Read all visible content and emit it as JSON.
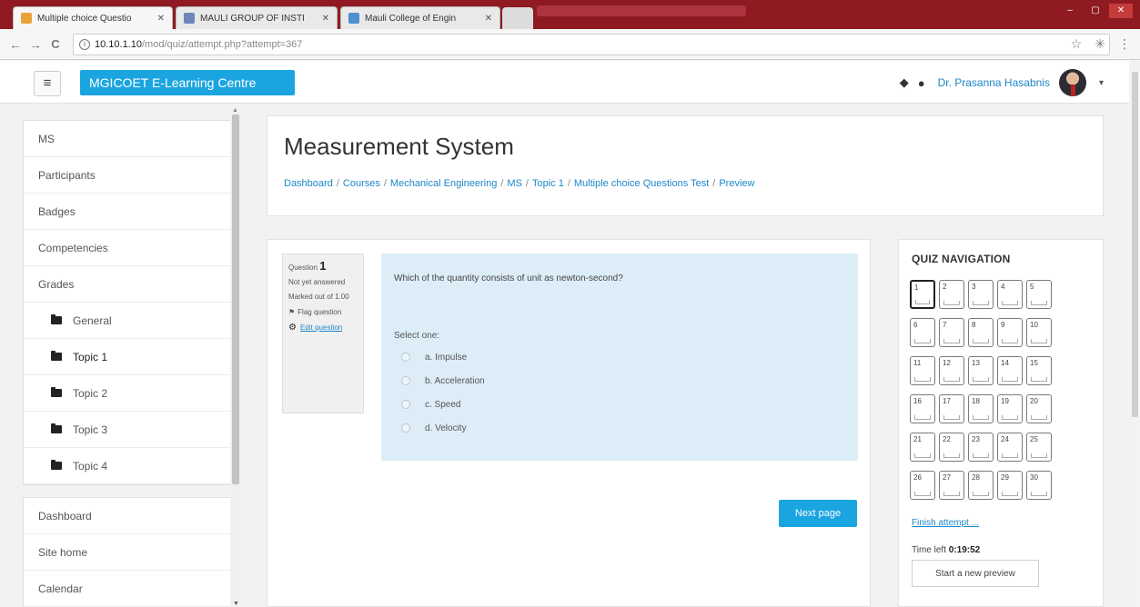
{
  "browser": {
    "tabs": [
      {
        "label": "Multiple choice Questio",
        "color": "#e8a23a",
        "active": true
      },
      {
        "label": "MAULI GROUP OF INSTI",
        "color": "#6c86b8",
        "active": false
      },
      {
        "label": "Mauli College of Engin",
        "color": "#4e8fd0",
        "active": false
      }
    ],
    "url_host": "10.10.1.10",
    "url_path": "/mod/quiz/attempt.php?attempt=367",
    "back": "←",
    "forward": "→",
    "reload": "C",
    "star": "☆",
    "menu": "⋮"
  },
  "topnav": {
    "brand": "MGICOET E-Learning Centre",
    "hamburger": "≡",
    "user_name": "Dr. Prasanna Hasabnis",
    "bell": "🔔",
    "chat": "💬",
    "caret": "▾"
  },
  "drawer": {
    "items": [
      {
        "label": "MS",
        "type": "plain"
      },
      {
        "label": "Participants",
        "type": "plain"
      },
      {
        "label": "Badges",
        "type": "plain"
      },
      {
        "label": "Competencies",
        "type": "plain"
      },
      {
        "label": "Grades",
        "type": "plain"
      },
      {
        "label": "General",
        "type": "folder"
      },
      {
        "label": "Topic 1",
        "type": "folder"
      },
      {
        "label": "Topic 2",
        "type": "folder"
      },
      {
        "label": "Topic 3",
        "type": "folder"
      },
      {
        "label": "Topic 4",
        "type": "folder"
      }
    ],
    "items2": [
      {
        "label": "Dashboard"
      },
      {
        "label": "Site home"
      },
      {
        "label": "Calendar"
      }
    ]
  },
  "header": {
    "title": "Measurement System",
    "breadcrumb": [
      "Dashboard",
      "Courses",
      "Mechanical Engineering",
      "MS",
      "Topic 1",
      "Multiple choice Questions Test",
      "Preview"
    ],
    "sep": "/"
  },
  "question": {
    "label": "Question",
    "number": "1",
    "status": "Not yet answered",
    "marked": "Marked out of 1.00",
    "flag": "Flag question",
    "edit": "Edit question",
    "text": "Which of the quantity consists of unit as newton-second?",
    "select_one": "Select one:",
    "options": [
      "a. Impulse",
      "b. Acceleration",
      "c. Speed",
      "d. Velocity"
    ],
    "next_label": "Next page"
  },
  "quiz_nav": {
    "title": "QUIZ NAVIGATION",
    "questions": [
      "1",
      "2",
      "3",
      "4",
      "5",
      "6",
      "7",
      "8",
      "9",
      "10",
      "11",
      "12",
      "13",
      "14",
      "15",
      "16",
      "17",
      "18",
      "19",
      "20",
      "21",
      "22",
      "23",
      "24",
      "25",
      "26",
      "27",
      "28",
      "29",
      "30"
    ],
    "current": "1",
    "finish": "Finish attempt ...",
    "time_label": "Time left",
    "time_value": "0:19:52",
    "new_preview": "Start a new preview"
  }
}
